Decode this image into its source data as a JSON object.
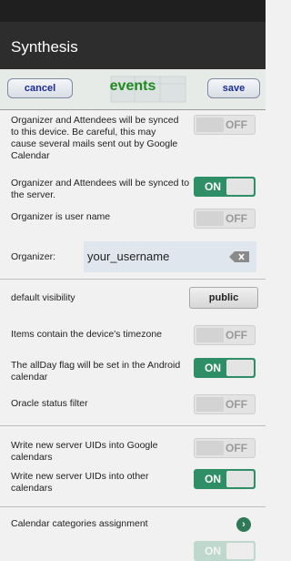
{
  "app_title": "Synthesis",
  "header": {
    "cancel_label": "cancel",
    "title": "events",
    "save_label": "save"
  },
  "settings": {
    "sync_to_device": {
      "label": "Organizer and Attendees will be synced to this device. Be careful, this may cause several mails sent out by Google Calendar",
      "state": "OFF"
    },
    "sync_to_server": {
      "label": "Organizer and Attendees will be synced to the server.",
      "state": "ON"
    },
    "organizer_is_username": {
      "label": "Organizer is user name",
      "state": "OFF"
    },
    "organizer": {
      "label": "Organizer:",
      "value": "your_username"
    },
    "default_visibility": {
      "label": "default visibility",
      "value": "public"
    },
    "device_timezone": {
      "label": "Items contain the device's timezone",
      "state": "OFF"
    },
    "allday_flag": {
      "label": "The allDay flag will be set in the Android calendar",
      "state": "ON"
    },
    "oracle_status_filter": {
      "label": "Oracle status filter",
      "state": "OFF"
    },
    "uids_google": {
      "label": "Write new server UIDs into Google calendars",
      "state": "OFF"
    },
    "uids_other": {
      "label": "Write new server UIDs into other calendars",
      "state": "ON"
    },
    "categories_assignment": {
      "label": "Calendar categories assignment"
    },
    "partial_toggle": {
      "state": "ON"
    }
  },
  "colors": {
    "toggle_on": "#2e8f66",
    "header_title": "#1f8a1f",
    "button_text": "#1b2e8f"
  },
  "icons": {
    "backspace": "backspace-icon",
    "chevron": "chevron-right-icon"
  }
}
